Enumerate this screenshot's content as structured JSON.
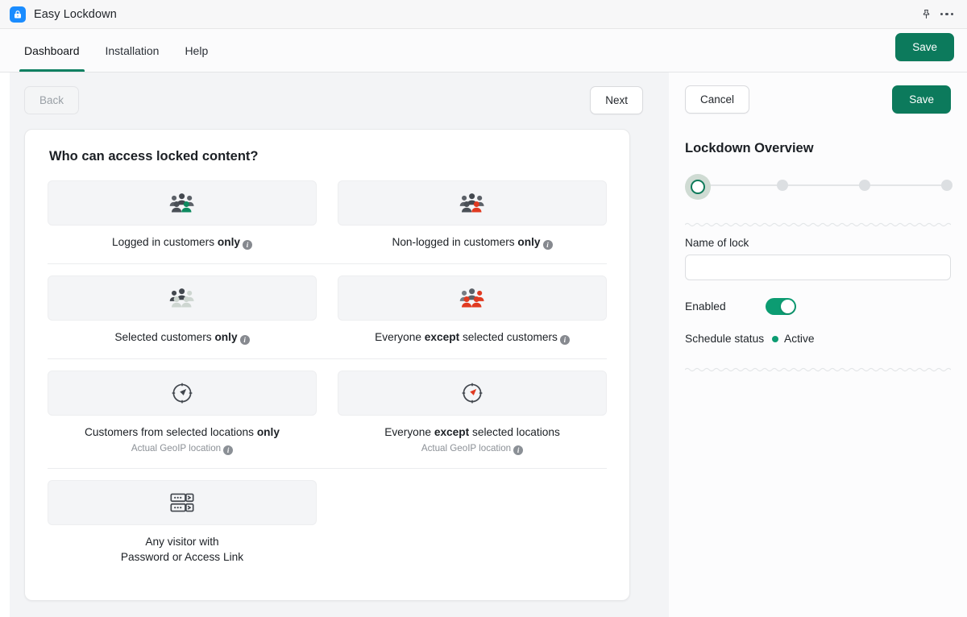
{
  "titlebar": {
    "app_name": "Easy Lockdown",
    "app_icon": "lock-icon",
    "pin_icon": "pin-icon",
    "more_icon": "more-horizontal-icon"
  },
  "nav": {
    "tabs": [
      {
        "label": "Dashboard",
        "active": true
      },
      {
        "label": "Installation",
        "active": false
      },
      {
        "label": "Help",
        "active": false
      }
    ],
    "save_label": "Save"
  },
  "toolbar": {
    "back_label": "Back",
    "back_disabled": true,
    "next_label": "Next"
  },
  "card": {
    "title": "Who can access locked content?",
    "options": [
      {
        "icon": "group-of-people-green-icon",
        "label_prefix": "Logged in customers ",
        "label_strong": "only",
        "label_suffix": "",
        "info": true,
        "sub": "",
        "sub_info": false
      },
      {
        "icon": "group-of-people-red-icon",
        "label_prefix": "Non-logged in customers ",
        "label_strong": "only",
        "label_suffix": "",
        "info": true,
        "sub": "",
        "sub_info": false
      },
      {
        "icon": "group-of-people-faded-icon",
        "label_prefix": "Selected customers ",
        "label_strong": "only",
        "label_suffix": "",
        "info": true,
        "sub": "",
        "sub_info": false
      },
      {
        "icon": "group-of-people-mixed-red-icon",
        "label_prefix": "Everyone ",
        "label_strong": "except",
        "label_suffix": " selected customers",
        "info": true,
        "sub": "",
        "sub_info": false
      },
      {
        "icon": "compass-dark-icon",
        "label_prefix": "Customers from selected locations ",
        "label_strong": "only",
        "label_suffix": "",
        "info": false,
        "sub": "Actual GeoIP location",
        "sub_info": true
      },
      {
        "icon": "compass-red-icon",
        "label_prefix": "Everyone ",
        "label_strong": "except",
        "label_suffix": " selected locations",
        "info": false,
        "sub": "Actual GeoIP location",
        "sub_info": true
      },
      {
        "icon": "password-access-link-icon",
        "label_prefix": "Any visitor with",
        "label_strong": "",
        "label_suffix": "",
        "label_line2": "Password or Access Link",
        "info": false,
        "sub": "",
        "sub_info": false
      }
    ]
  },
  "panel": {
    "cancel_label": "Cancel",
    "save_label": "Save",
    "heading": "Lockdown Overview",
    "steps": {
      "total": 4,
      "current": 1
    },
    "name_label": "Name of lock",
    "name_value": "",
    "name_placeholder": "",
    "enabled_label": "Enabled",
    "enabled_on": true,
    "schedule_label": "Schedule status",
    "schedule_status": "Active"
  },
  "colors": {
    "brand_green": "#0c7a5c",
    "toggle_green": "#0c9c72",
    "accent_red": "#e03a21",
    "app_icon_blue": "#1a8cff",
    "panel_bg": "#fcfcfd",
    "content_bg": "#f3f4f6"
  }
}
